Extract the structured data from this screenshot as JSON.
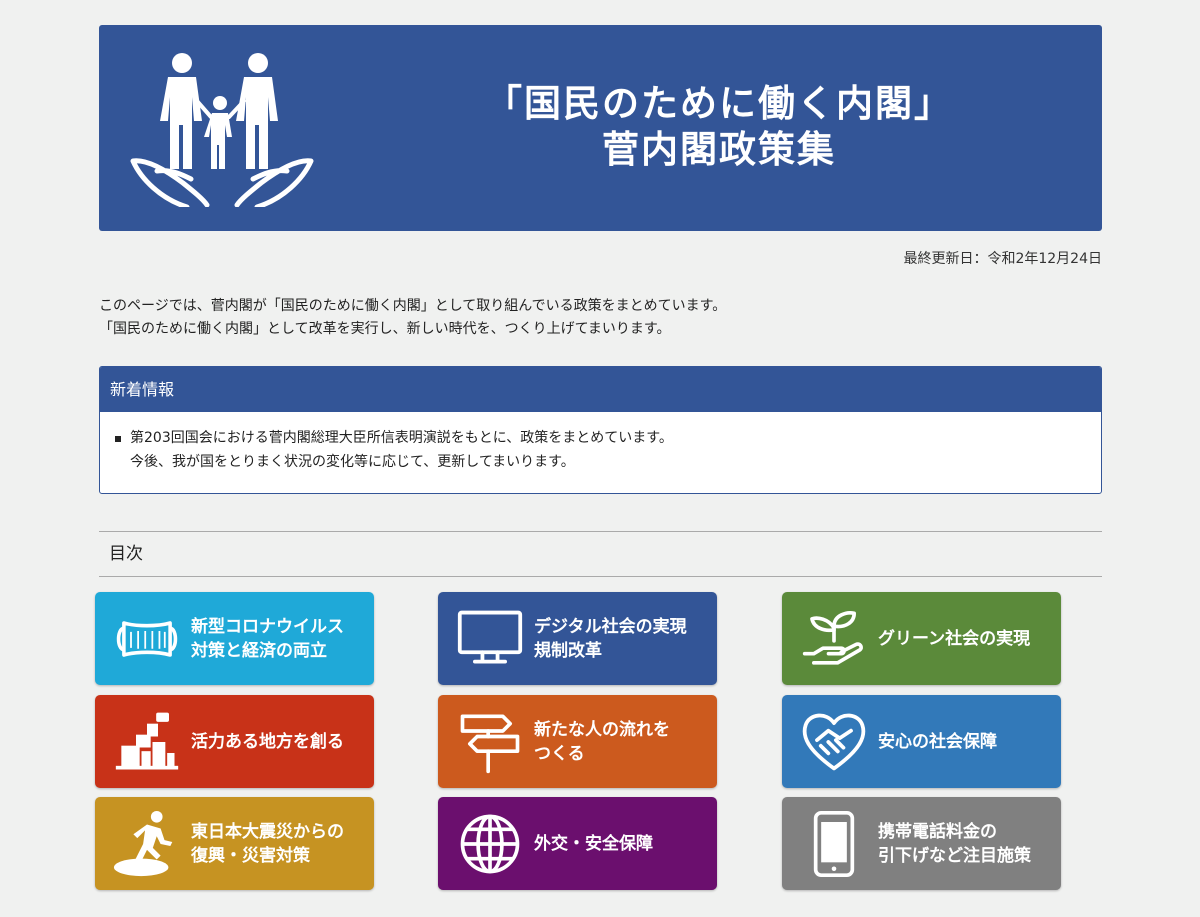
{
  "banner": {
    "title_line1": "「国民のために働く内閣」",
    "title_line2": "菅内閣政策集",
    "icon": "family-hands-icon",
    "color": "#335597"
  },
  "updated": "最終更新日：令和2年12月24日",
  "intro": {
    "line1": "このページでは、菅内閣が「国民のために働く内閣」として取り組んでいる政策をまとめています。",
    "line2": "「国民のために働く内閣」として改革を実行し、新しい時代を、つくり上げてまいります。"
  },
  "news": {
    "heading": "新着情報",
    "line1": "第203回国会における菅内閣総理大臣所信表明演説をもとに、政策をまとめています。",
    "line2": "今後、我が国をとりまく状況の変化等に応じて、更新してまいります。"
  },
  "toc": {
    "heading": "目次",
    "tiles": [
      {
        "label": "新型コロナウイルス\n対策と経済の両立",
        "color": "#1fa9d8",
        "icon": "mask-icon"
      },
      {
        "label": "デジタル社会の実現\n規制改革",
        "color": "#335597",
        "icon": "monitor-icon"
      },
      {
        "label": "グリーン社会の実現",
        "color": "#5b8a3a",
        "icon": "sprout-hand-icon"
      },
      {
        "label": "活力ある地方を創る",
        "color": "#c83218",
        "icon": "town-icon"
      },
      {
        "label": "新たな人の流れを\nつくる",
        "color": "#cc5a1e",
        "icon": "signpost-icon"
      },
      {
        "label": "安心の社会保障",
        "color": "#3279b9",
        "icon": "heart-handshake-icon"
      },
      {
        "label": "東日本大震災からの\n復興・災害対策",
        "color": "#c69322",
        "icon": "runner-icon"
      },
      {
        "label": "外交・安全保障",
        "color": "#6b0f6e",
        "icon": "globe-icon"
      },
      {
        "label": "携帯電話料金の\n引下げなど注目施策",
        "color": "#808080",
        "icon": "smartphone-icon"
      }
    ]
  }
}
